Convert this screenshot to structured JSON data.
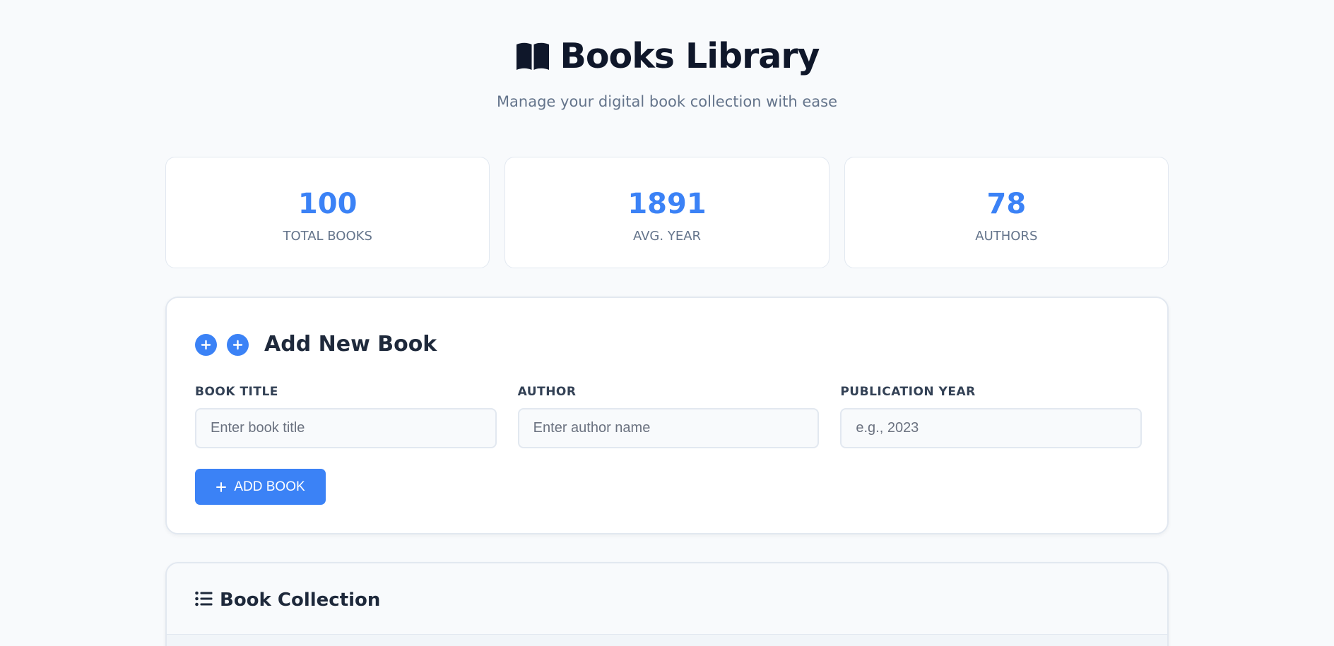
{
  "header": {
    "title": "Books Library",
    "subtitle": "Manage your digital book collection with ease",
    "icon": "open-book-icon"
  },
  "stats": [
    {
      "value": "100",
      "label": "TOTAL BOOKS"
    },
    {
      "value": "1891",
      "label": "AVG. YEAR"
    },
    {
      "value": "78",
      "label": "AUTHORS"
    }
  ],
  "add_form": {
    "title": "Add New Book",
    "icons": [
      "plus-circle-icon",
      "plus-circle-icon"
    ],
    "fields": [
      {
        "label": "BOOK TITLE",
        "placeholder": "Enter book title",
        "value": ""
      },
      {
        "label": "AUTHOR",
        "placeholder": "Enter author name",
        "value": ""
      },
      {
        "label": "PUBLICATION YEAR",
        "placeholder": "e.g., 2023",
        "value": ""
      }
    ],
    "submit_label": "ADD BOOK"
  },
  "collection": {
    "title": "Book Collection",
    "icon": "list-icon"
  },
  "colors": {
    "accent": "#3b82f6",
    "text_dark": "#0f172a",
    "text_muted": "#64748b",
    "background": "#f8fafc",
    "border": "#e2e8f0"
  }
}
